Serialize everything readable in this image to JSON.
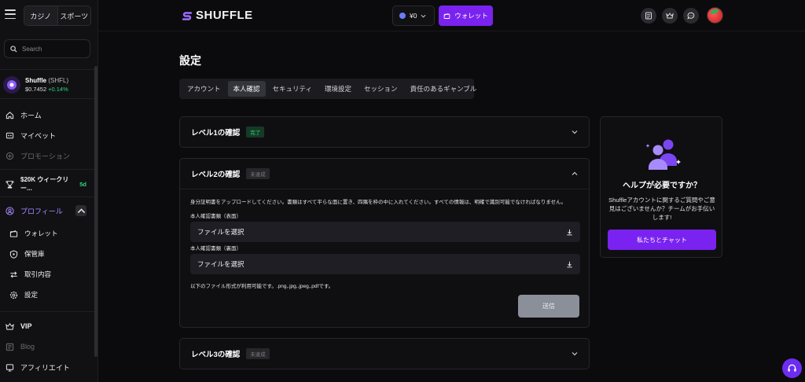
{
  "sidebar": {
    "mode_tabs": [
      "カジノ",
      "スポーツ"
    ],
    "search_placeholder": "Search",
    "token": {
      "name": "Shuffle",
      "symbol": "(SHFL)",
      "price": "$0.7452",
      "change": "+0.14%"
    },
    "items": [
      {
        "label": "ホーム",
        "icon": "home-icon"
      },
      {
        "label": "マイベット",
        "icon": "bets-icon"
      },
      {
        "label": "プロモーション",
        "icon": "promo-icon"
      }
    ],
    "weekly": {
      "label": "$20K ウィークリー...",
      "badge": "5d"
    },
    "profile": {
      "label": "プロフィール"
    },
    "profile_items": [
      {
        "label": "ウォレット",
        "icon": "wallet-icon"
      },
      {
        "label": "保管庫",
        "icon": "vault-icon"
      },
      {
        "label": "取引内容",
        "icon": "transactions-icon"
      },
      {
        "label": "設定",
        "icon": "settings-icon"
      }
    ],
    "bottom_items": [
      {
        "label": "VIP",
        "icon": "vip-icon"
      },
      {
        "label": "Blog",
        "icon": "blog-icon"
      },
      {
        "label": "アフィリエイト",
        "icon": "affiliate-icon"
      }
    ]
  },
  "header": {
    "brand": "SHUFFLE",
    "balance": "¥0",
    "wallet_label": "ウォレット"
  },
  "main": {
    "title": "設定",
    "tabs": [
      "アカウント",
      "本人確認",
      "セキュリティ",
      "環境設定",
      "セッション",
      "責任のあるギャンブル"
    ],
    "level1": {
      "title": "レベル1の確認",
      "status": "完了"
    },
    "level2": {
      "title": "レベル2の確認",
      "status": "未達成",
      "description": "身分証明書をアップロードしてください。書類はすべて平らな面に置き、四隅を枠の中に入れてください。すべての情報は、明確で識別可能でなければなりません。",
      "front_label": "本人確認書類（表面）",
      "back_label": "本人確認書類（裏面）",
      "file_button": "ファイルを選択",
      "formats": "以下のファイル形式が利用可能です。.png,.jpg,.jpeg,.pdfです。",
      "submit": "送信"
    },
    "level3": {
      "title": "レベル3の確認",
      "status": "未達成"
    }
  },
  "help": {
    "title": "ヘルプが必要ですか？",
    "text": "Shuffleアカウントに関するご質問やご意見はございませんか？チームがお手伝いします!",
    "button": "私たちとチャット"
  },
  "colors": {
    "accent": "#7a22f0",
    "success": "#2bd97a",
    "panel": "#0f0f12"
  }
}
